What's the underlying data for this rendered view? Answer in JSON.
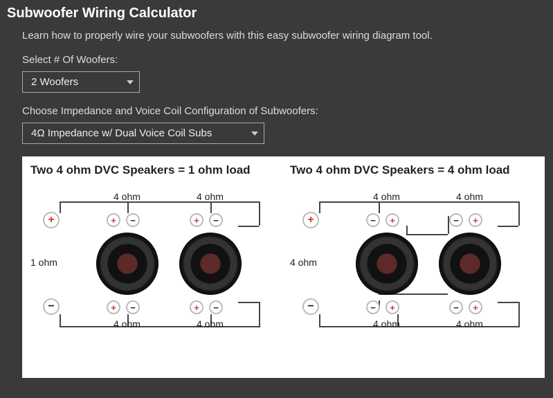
{
  "title": "Subwoofer Wiring Calculator",
  "intro": "Learn how to properly wire your subwoofers with this easy subwoofer wiring diagram tool.",
  "woofers_label": "Select # Of Woofers:",
  "woofers_value": "2 Woofers",
  "impedance_label": "Choose Impedance and Voice Coil Configuration of Subwoofers:",
  "impedance_value": "4Ω Impedance w/ Dual Voice Coil Subs",
  "diagrams": [
    {
      "title": "Two 4 ohm DVC Speakers = 1 ohm load",
      "amp_load": "1 ohm",
      "coil": "4 ohm"
    },
    {
      "title": "Two 4 ohm DVC Speakers = 4 ohm load",
      "amp_load": "4 ohm",
      "coil": "4 ohm"
    }
  ]
}
